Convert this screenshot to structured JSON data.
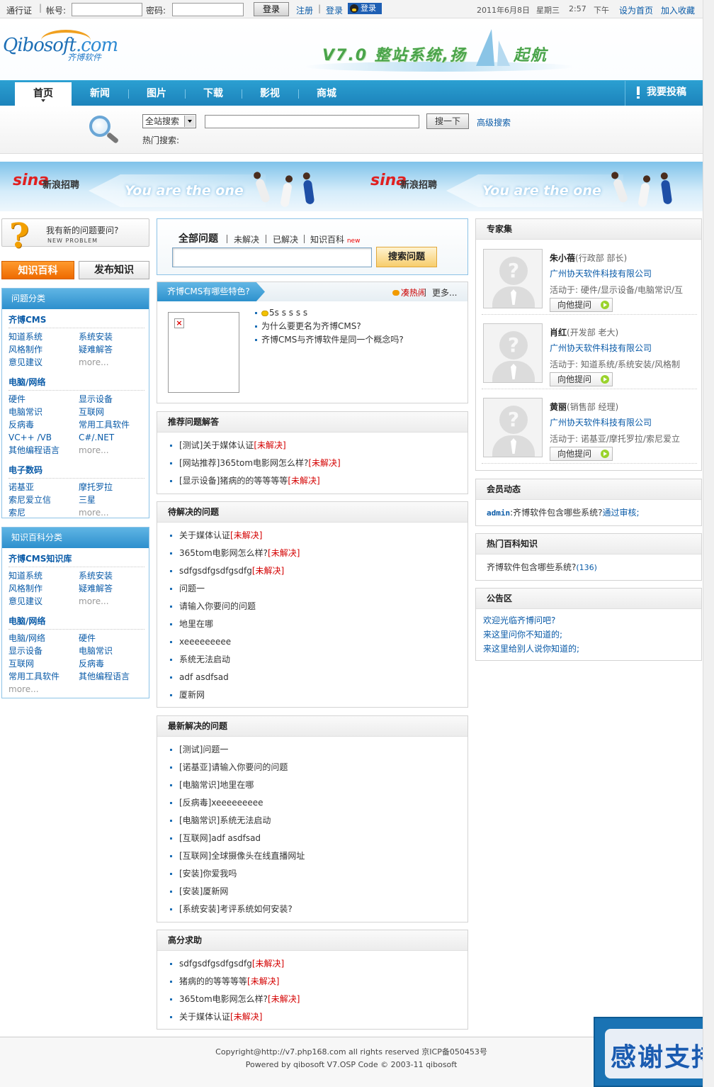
{
  "topbar": {
    "passport": "通行证",
    "account_label": "帐号:",
    "password_label": "密码:",
    "login_btn": "登录",
    "register": "注册",
    "login_link": "登录",
    "qq_login": "登录",
    "date": "2011年6月8日",
    "weekday": "星期三",
    "time": "2:57",
    "ampm": "下午",
    "set_home": "设为首页",
    "bookmark": "加入收藏"
  },
  "header": {
    "logo_main": "Qibosoft",
    "logo_dot": ".com",
    "logo_sub": "齐博软件",
    "slogan": "V7.0 整站系统,扬",
    "slogan_end": "起航"
  },
  "nav": {
    "items": [
      "首页",
      "新闻",
      "图片",
      "下载",
      "影视",
      "商城"
    ],
    "contribute": "我要投稿"
  },
  "search": {
    "scope": "全站搜索",
    "button": "搜一下",
    "advanced": "高级搜索",
    "hot_label": "热门搜索:"
  },
  "banner": {
    "brand": "sina",
    "brand_sub": "新浪招聘",
    "slogan": "You are the one"
  },
  "left": {
    "ask_title": "我有新的问题要问?",
    "ask_sub": "NEW PROBLEM",
    "wiki_btn": "知识百科",
    "publish_btn": "发布知识",
    "box1": {
      "title": "问题分类",
      "groups": [
        {
          "name": "齐博CMS",
          "items": [
            [
              "知道系统",
              "系统安装"
            ],
            [
              "风格制作",
              "疑难解答"
            ],
            [
              "意见建议",
              "more..."
            ]
          ]
        },
        {
          "name": "电脑/网络",
          "items": [
            [
              "硬件",
              "显示设备"
            ],
            [
              "电脑常识",
              "互联网"
            ],
            [
              "反病毒",
              "常用工具软件"
            ],
            [
              "VC++ /VB",
              "C#/.NET"
            ],
            [
              "其他编程语言",
              "more..."
            ]
          ]
        },
        {
          "name": "电子数码",
          "items": [
            [
              "诺基亚",
              "摩托罗拉"
            ],
            [
              "索尼爱立信",
              "三星"
            ],
            [
              "索尼",
              "more..."
            ]
          ]
        }
      ]
    },
    "box2": {
      "title": "知识百科分类",
      "groups": [
        {
          "name": "齐博CMS知识库",
          "items": [
            [
              "知道系统",
              "系统安装"
            ],
            [
              "风格制作",
              "疑难解答"
            ],
            [
              "意见建议",
              "more..."
            ]
          ]
        },
        {
          "name": "电脑/网络",
          "items": [
            [
              "电脑/网络",
              "硬件"
            ],
            [
              "显示设备",
              "电脑常识"
            ],
            [
              "互联网",
              "反病毒"
            ],
            [
              "常用工具软件",
              "其他编程语言"
            ],
            [
              "more...",
              ""
            ]
          ]
        }
      ]
    }
  },
  "center": {
    "tabs": {
      "all": "全部问题",
      "unsolved": "未解决",
      "solved": "已解决",
      "wiki": "知识百科",
      "new": "new"
    },
    "ask_btn": "搜索问题",
    "feature": {
      "title": "齐博CMS有哪些特色?",
      "hot": "凑热闹",
      "more": "更多...",
      "items": [
        "5s s s s s",
        "为什么要更名为齐博CMS?",
        "齐博CMS与齐博软件是同一个概念吗?"
      ]
    },
    "recommend": {
      "title": "推荐问题解答",
      "items": [
        {
          "text": "[测试]关于媒体认证",
          "tag": "[未解决]"
        },
        {
          "text": "[网站推荐]365tom电影网怎么样?",
          "tag": "[未解决]"
        },
        {
          "text": "[显示设备]猪病的的等等等等",
          "tag": "[未解决]"
        }
      ]
    },
    "pending": {
      "title": "待解决的问题",
      "items": [
        {
          "text": "关于媒体认证",
          "tag": "[未解决]"
        },
        {
          "text": "365tom电影网怎么样?",
          "tag": "[未解决]"
        },
        {
          "text": "sdfgsdfgsdfgsdfg",
          "tag": "[未解决]"
        },
        {
          "text": "问题一",
          "tag": ""
        },
        {
          "text": "请输入你要问的问题",
          "tag": ""
        },
        {
          "text": "地里在哪",
          "tag": ""
        },
        {
          "text": "xeeeeeeeee",
          "tag": ""
        },
        {
          "text": "系统无法启动",
          "tag": ""
        },
        {
          "text": "adf asdfsad",
          "tag": ""
        },
        {
          "text": "厦新网",
          "tag": ""
        }
      ]
    },
    "solved": {
      "title": "最新解决的问题",
      "items": [
        "[测试]问题一",
        "[诺基亚]请输入你要问的问题",
        "[电脑常识]地里在哪",
        "[反病毒]xeeeeeeeee",
        "[电脑常识]系统无法启动",
        "[互联网]adf asdfsad",
        "[互联网]全球摄像头在线直播网址",
        "[安装]你爱我吗",
        "[安装]厦新网",
        "[系统安装]考评系统如何安装?"
      ]
    },
    "highscore": {
      "title": "高分求助",
      "items": [
        {
          "text": "sdfgsdfgsdfgsdfg",
          "tag": "[未解决]"
        },
        {
          "text": "猪病的的等等等等",
          "tag": "[未解决]"
        },
        {
          "text": "365tom电影网怎么样?",
          "tag": "[未解决]"
        },
        {
          "text": "关于媒体认证",
          "tag": "[未解决]"
        }
      ]
    }
  },
  "right": {
    "experts_title": "专家集",
    "experts": [
      {
        "name": "朱小蓓",
        "role": "(行政部 部长)",
        "company": "广州协天软件科技有限公司",
        "active": "活动于: 硬件/显示设备/电脑常识/互",
        "ask": "向他提问"
      },
      {
        "name": "肖红",
        "role": "(开发部 老大)",
        "company": "广州协天软件科技有限公司",
        "active": "活动于: 知道系统/系统安装/风格制",
        "ask": "向他提问"
      },
      {
        "name": "黄丽",
        "role": "(销售部 经理)",
        "company": "广州协天软件科技有限公司",
        "active": "活动于: 诺基亚/摩托罗拉/索尼爱立",
        "ask": "向他提问"
      }
    ],
    "members": {
      "title": "会员动态",
      "user": "admin",
      "text": ":齐博软件包含哪些系统?",
      "link": "通过审核;"
    },
    "hotwiki": {
      "title": "热门百科知识",
      "item": "齐博软件包含哪些系统?",
      "count": "(136)"
    },
    "notice": {
      "title": "公告区",
      "items": [
        "欢迎光临齐博问吧?",
        "来这里问你不知道的;",
        "来这里给别人说你知道的;"
      ]
    }
  },
  "footer": {
    "line1": "Copyright@http://v7.php168.com all rights reserved 京ICP备050453号",
    "line2": "Powered by qibosoft V7.OSP Code © 2003-11 qibosoft"
  },
  "thanks": "感谢支持"
}
